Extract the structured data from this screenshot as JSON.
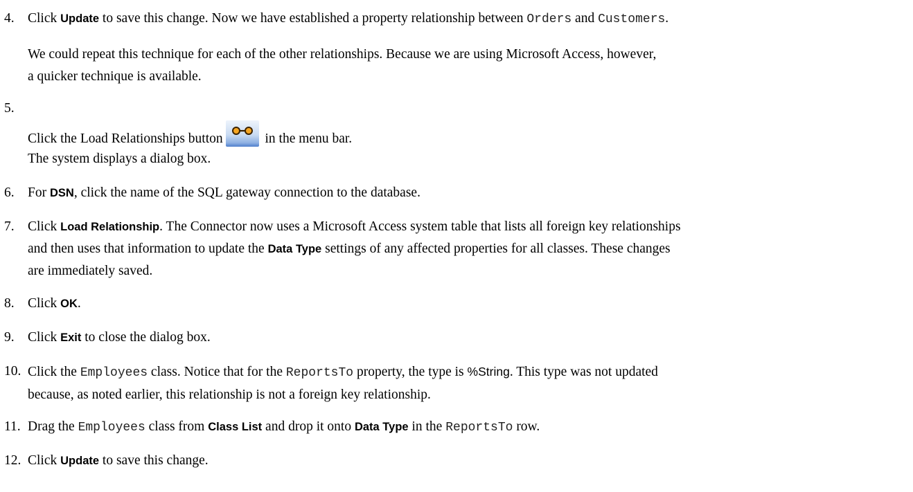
{
  "steps": [
    {
      "num": "4.",
      "a": "Click ",
      "b": "Update",
      "c": " to save this change. Now we have established a property relationship between ",
      "d": "Orders",
      "e": " and ",
      "f": "Customers",
      "g": "."
    },
    {
      "num": "5.",
      "a": "Click the Load Relationships button",
      "icon": "load-relationships-icon",
      "b": " in the menu bar."
    },
    {
      "num": "6.",
      "a": "For ",
      "b": "DSN",
      "c": ", click the name of the SQL gateway connection to the database."
    },
    {
      "num": "7.",
      "a": "Click ",
      "b": "Load Relationship",
      "c": ". The Connector now uses a Microsoft Access system table that lists all foreign key relationships",
      "d": "and then uses that information to update the ",
      "e": "Data Type",
      "f": " settings of any affected properties for all classes. These changes",
      "g": "are immediately saved."
    },
    {
      "num": "8.",
      "a": "Click ",
      "b": "OK",
      "c": "."
    },
    {
      "num": "9.",
      "a": "Click ",
      "b": "Exit",
      "c": " to close the dialog box."
    },
    {
      "num": "10.",
      "a": "Click the ",
      "b": "Employees",
      "c": " class. Notice that for the ",
      "d": "ReportsTo",
      "e": " property, the type is ",
      "f": "%String",
      "g": ". This type was not updated",
      "h": "because, as noted earlier, this relationship is not a foreign key relationship."
    },
    {
      "num": "11.",
      "a": "Drag the ",
      "b": "Employees",
      "c": " class from ",
      "d": "Class List",
      "e": " and drop it onto ",
      "f": "Data Type",
      "g": " in the ",
      "h": "ReportsTo",
      "i": " row."
    },
    {
      "num": "12.",
      "a": "Click ",
      "b": "Update",
      "c": " to save this change."
    }
  ],
  "paras": {
    "p1_line1": "We could repeat this technique for each of the other relationships. Because we are using Microsoft Access, however,",
    "p1_line2": "a quicker technique is available.",
    "p2": "The system displays a dialog box."
  },
  "colors": {
    "icon_circle": "#f5a623",
    "icon_outline": "#3a2200",
    "icon_bg_bottom": "#4f7fcc"
  }
}
